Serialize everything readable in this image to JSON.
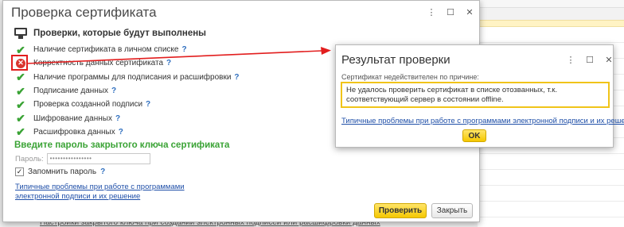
{
  "background": {
    "bottom_link": "Настройки закрытого ключа при создании электронных подписей или расшифровки данных"
  },
  "main_dialog": {
    "title": "Проверка сертификата",
    "controls": {
      "menu": "⋮",
      "maximize": "☐",
      "close": "✕"
    },
    "section_title": "Проверки, которые будут выполнены",
    "checks": [
      {
        "label": "Наличие сертификата в личном списке",
        "status": "ok",
        "help": "?"
      },
      {
        "label": "Корректность данных сертификата",
        "status": "error",
        "help": "?"
      },
      {
        "label": "Наличие программы для подписания и расшифровки",
        "status": "ok",
        "help": "?"
      },
      {
        "label": "Подписание данных",
        "status": "ok",
        "help": "?"
      },
      {
        "label": "Проверка созданной подписи",
        "status": "ok",
        "help": "?"
      },
      {
        "label": "Шифрование данных",
        "status": "ok",
        "help": "?"
      },
      {
        "label": "Расшифровка данных",
        "status": "ok",
        "help": "?"
      }
    ],
    "password_section_title": "Введите пароль закрытого ключа сертификата",
    "password_label": "Пароль:",
    "password_value": "••••••••••••••••",
    "remember_label": "Запомнить пароль",
    "remember_checked": "✓",
    "remember_help": "?",
    "problems_link": "Типичные проблемы при работе с программами электронной подписи и их решение",
    "check_button": "Проверить",
    "close_button": "Закрыть"
  },
  "result_dialog": {
    "title": "Результат проверки",
    "controls": {
      "menu": "⋮",
      "maximize": "☐",
      "close": "✕"
    },
    "reason_label": "Сертификат недействителен по причине:",
    "reason_text": "Не удалось проверить сертификат в списке отозванных, т.к. соответствующий сервер в состоянии offline.",
    "problems_link": "Типичные проблемы при работе с программами электронной подписи и их решение",
    "ok_button": "OK"
  },
  "icons": {
    "ok": "✔",
    "error": "✕",
    "monitor": "monitor-icon"
  },
  "colors": {
    "ok_green": "#3aa335",
    "error_red": "#e21e1e",
    "link_blue": "#1f4fa8",
    "primary_yellow": "#f5c800",
    "highlight_border": "#f0c419"
  }
}
